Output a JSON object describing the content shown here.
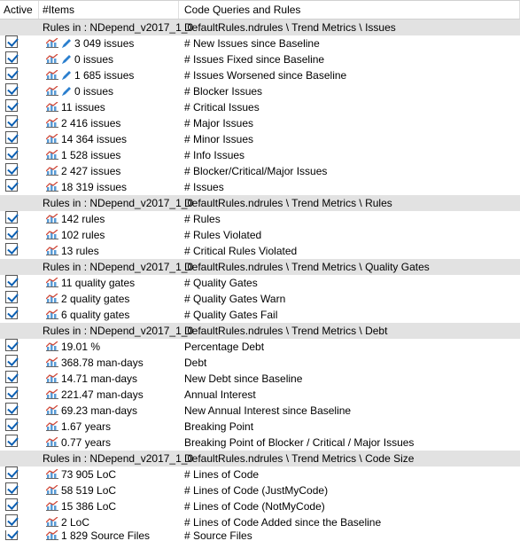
{
  "columns": {
    "active": "Active",
    "items": "#Items",
    "query": "Code Queries and Rules"
  },
  "group_path_root": "DefaultRules.ndrules \\ Trend Metrics \\",
  "project_label_prefix": "Rules in :   NDepend_v2017_1_0",
  "groups": [
    {
      "name": "Issues",
      "rows": [
        {
          "items": "3 049 issues",
          "query": "# New Issues since Baseline",
          "pen": true
        },
        {
          "items": "0 issues",
          "query": "# Issues Fixed since Baseline",
          "pen": true
        },
        {
          "items": "1 685 issues",
          "query": "# Issues Worsened since Baseline",
          "pen": true
        },
        {
          "items": "0 issues",
          "query": "# Blocker Issues",
          "pen": true
        },
        {
          "items": "11 issues",
          "query": "# Critical Issues"
        },
        {
          "items": "2 416 issues",
          "query": "# Major Issues"
        },
        {
          "items": "14 364 issues",
          "query": "# Minor Issues"
        },
        {
          "items": "1 528 issues",
          "query": "# Info Issues"
        },
        {
          "items": "2 427 issues",
          "query": "# Blocker/Critical/Major Issues"
        },
        {
          "items": "18 319 issues",
          "query": "# Issues"
        }
      ]
    },
    {
      "name": "Rules",
      "rows": [
        {
          "items": "142 rules",
          "query": "# Rules"
        },
        {
          "items": "102 rules",
          "query": "# Rules Violated"
        },
        {
          "items": "13 rules",
          "query": "# Critical Rules Violated"
        }
      ]
    },
    {
      "name": "Quality Gates",
      "rows": [
        {
          "items": "11 quality gates",
          "query": "# Quality Gates"
        },
        {
          "items": "2 quality gates",
          "query": "# Quality Gates Warn"
        },
        {
          "items": "6 quality gates",
          "query": "# Quality Gates Fail"
        }
      ]
    },
    {
      "name": "Debt",
      "rows": [
        {
          "items": "19.01 %",
          "query": "Percentage Debt"
        },
        {
          "items": "368.78 man-days",
          "query": "Debt"
        },
        {
          "items": "14.71 man-days",
          "query": "New Debt since Baseline"
        },
        {
          "items": "221.47 man-days",
          "query": "Annual Interest"
        },
        {
          "items": "69.23 man-days",
          "query": "New Annual Interest since Baseline"
        },
        {
          "items": "1.67 years",
          "query": "Breaking Point"
        },
        {
          "items": "0.77 years",
          "query": "Breaking Point of Blocker / Critical / Major Issues"
        }
      ]
    },
    {
      "name": "Code Size",
      "rows": [
        {
          "items": "73 905 LoC",
          "query": "# Lines of Code"
        },
        {
          "items": "58 519 LoC",
          "query": "# Lines of Code (JustMyCode)"
        },
        {
          "items": "15 386 LoC",
          "query": "# Lines of Code (NotMyCode)"
        },
        {
          "items": "2 LoC",
          "query": "# Lines of Code Added since the Baseline"
        },
        {
          "items": "1 829 Source Files",
          "query": "# Source Files",
          "partial": true
        }
      ]
    }
  ]
}
